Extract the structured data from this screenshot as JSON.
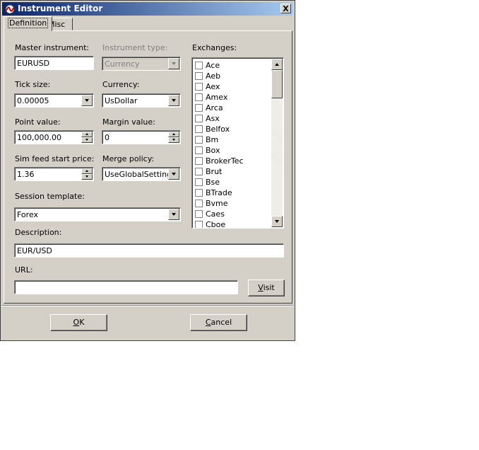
{
  "window": {
    "title": "Instrument Editor",
    "close_label": "X"
  },
  "tabs": [
    {
      "label": "Definition"
    },
    {
      "label": "Misc"
    }
  ],
  "fields": {
    "master_instrument": {
      "label": "Master instrument:",
      "value": "EURUSD"
    },
    "instrument_type": {
      "label": "Instrument type:",
      "value": "Currency"
    },
    "tick_size": {
      "label": "Tick size:",
      "value": "0.00005"
    },
    "currency": {
      "label": "Currency:",
      "value": "UsDollar"
    },
    "point_value": {
      "label": "Point value:",
      "value": "100,000.00"
    },
    "margin_value": {
      "label": "Margin value:",
      "value": "0"
    },
    "sim_feed_start_price": {
      "label": "Sim feed start price:",
      "value": "1.36"
    },
    "merge_policy": {
      "label": "Merge policy:",
      "value": "UseGlobalSettings"
    },
    "session_template": {
      "label": "Session template:",
      "value": "Forex"
    },
    "description": {
      "label": "Description:",
      "value": "EUR/USD"
    },
    "url": {
      "label": "URL:",
      "value": ""
    }
  },
  "exchanges": {
    "label": "Exchanges:",
    "items": [
      "Ace",
      "Aeb",
      "Aex",
      "Amex",
      "Arca",
      "Asx",
      "Belfox",
      "Bm",
      "Box",
      "BrokerTec",
      "Brut",
      "Bse",
      "BTrade",
      "Bvme",
      "Caes",
      "Cboe"
    ]
  },
  "buttons": {
    "visit": {
      "label": "Visit",
      "mnemonic": "V",
      "rest": "isit"
    },
    "ok": {
      "label": "OK",
      "mnemonic": "O",
      "rest": "K"
    },
    "cancel": {
      "label": "Cancel",
      "mnemonic": "C",
      "rest": "ancel"
    }
  },
  "colors": {
    "title_start": "#0a246a",
    "title_end": "#a6caf0",
    "face": "#d4d0c8",
    "icon_red": "#c00000"
  }
}
